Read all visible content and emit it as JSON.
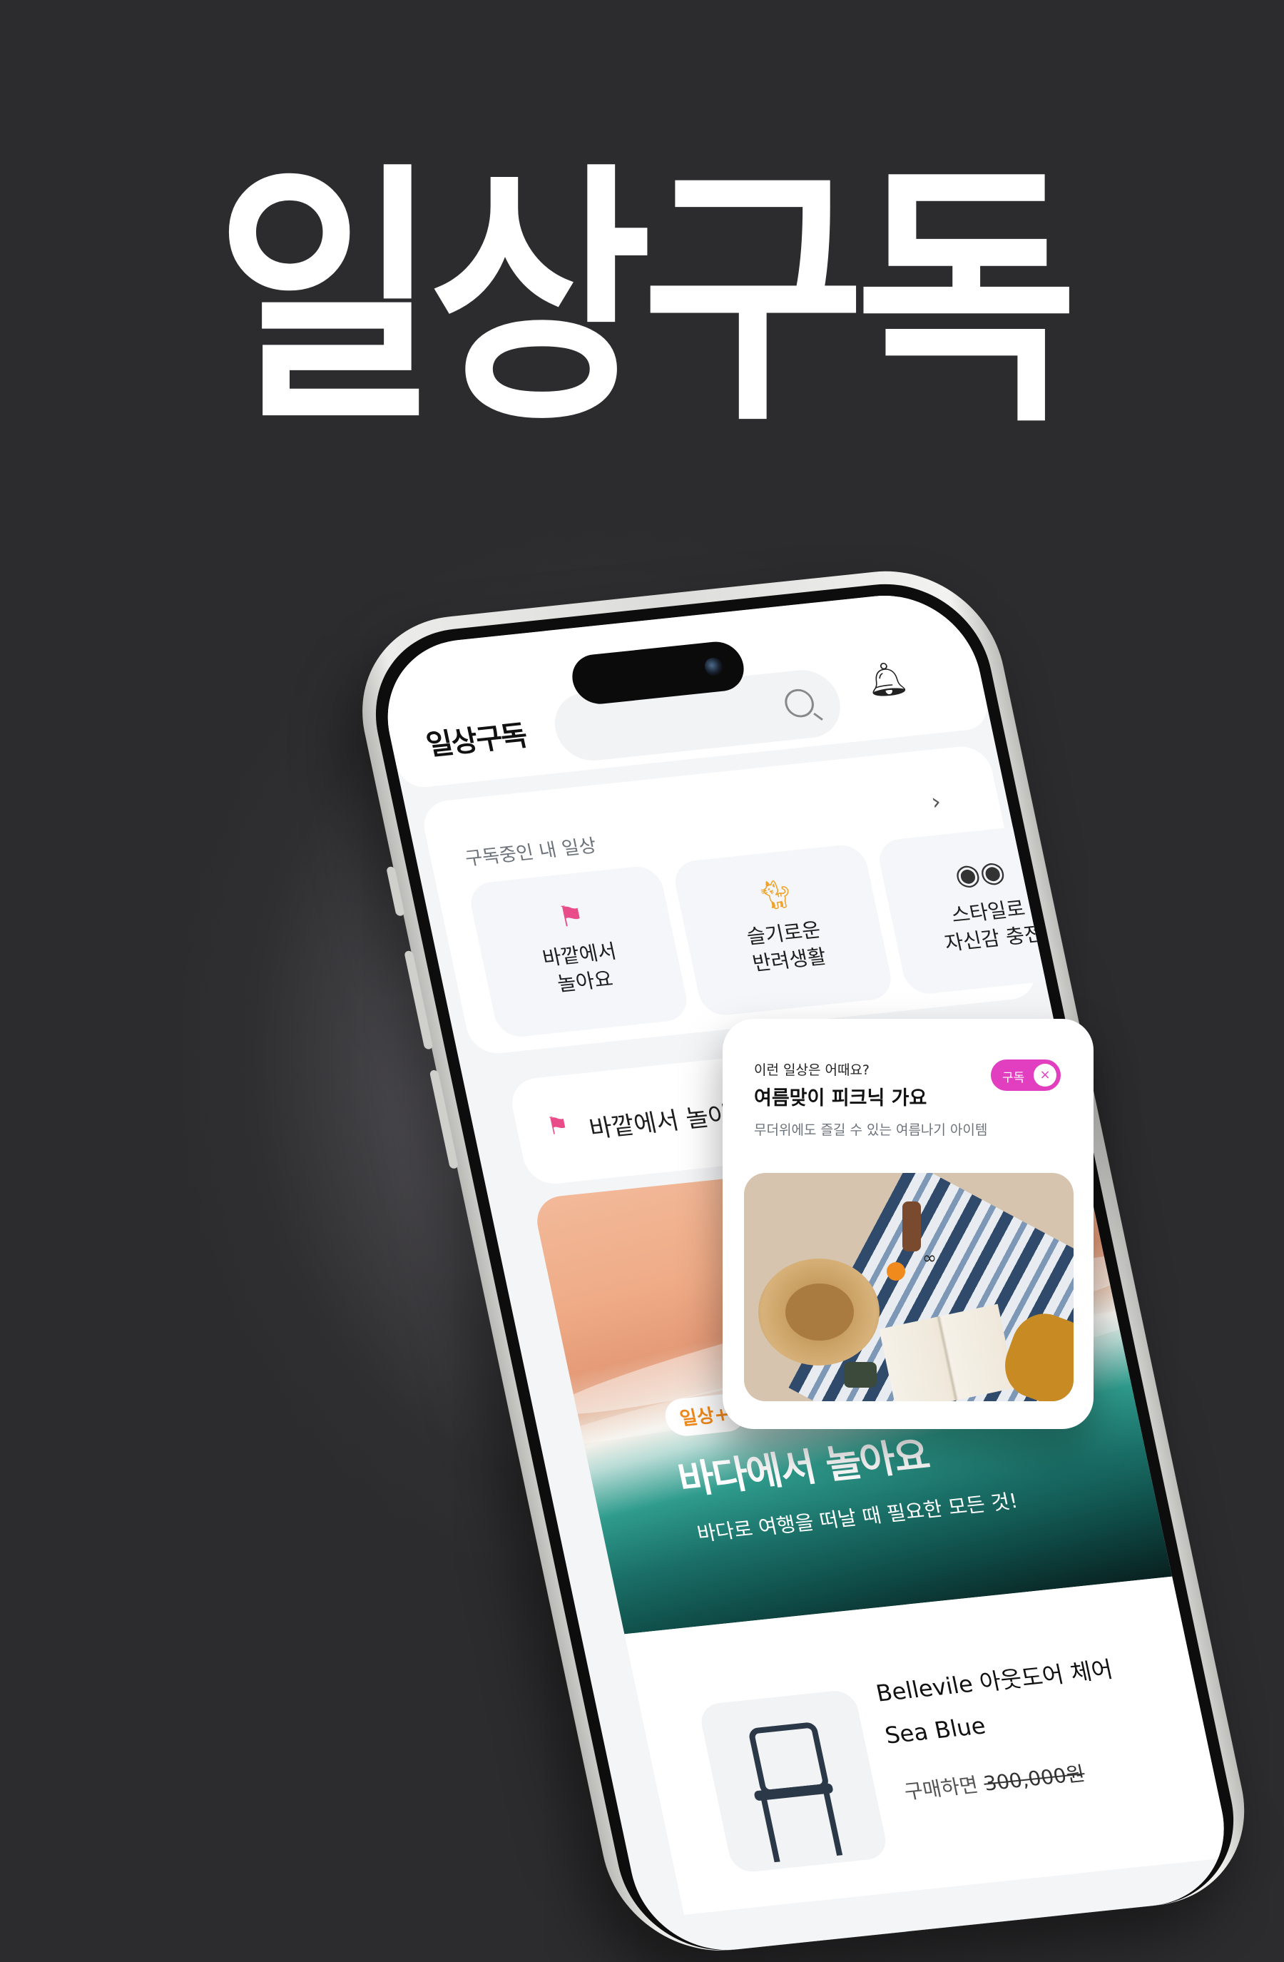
{
  "hero": {
    "title": "일상구독"
  },
  "app": {
    "logo": "일상구독",
    "icons": {
      "search": "search-icon",
      "notification": "bell-icon"
    }
  },
  "subscriptions": {
    "title": "구독중인 내 일상",
    "more_icon": "chevron-right-icon",
    "items": [
      {
        "label": "바깥에서\n놀아요",
        "icon": "signpost-icon"
      },
      {
        "label": "슬기로운\n반려생활",
        "icon": "cat-icon"
      },
      {
        "label": "스타일로\n자신감 충전",
        "icon": "sunglasses-icon"
      }
    ]
  },
  "section": {
    "title": "바깥에서 놀아요",
    "icon": "signpost-icon"
  },
  "banner": {
    "badge": "일상+",
    "title": "바다에서 놀아요",
    "subtitle": "바다로 여행을 떠날 때 필요한 모든 것!"
  },
  "product": {
    "name": "Bellevile 아웃도어 체어 Sea Blue",
    "price_prefix": "구매하면",
    "original_price": "300,000원",
    "favorite_icon": "heart-icon"
  },
  "recommend_card": {
    "question": "이런 일상은 어때요?",
    "title": "여름맞이 피크닉 가요",
    "description": "무더위에도 즐길 수 있는 여름나기 아이템",
    "toggle_label": "구독",
    "toggle_icon": "close-icon",
    "toggle_on": true
  },
  "colors": {
    "background": "#2c2c2e",
    "accent_pink": "#e13fbf",
    "badge_orange": "#f08a1c"
  }
}
